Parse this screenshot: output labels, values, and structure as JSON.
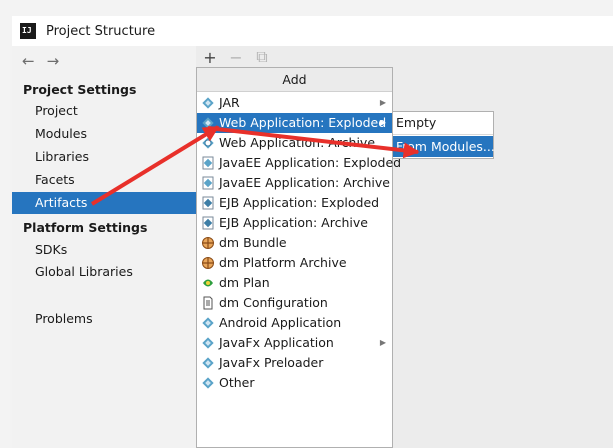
{
  "window": {
    "title": "Project Structure",
    "logo_text": "IJ"
  },
  "nav": {
    "back_glyph": "←",
    "forward_glyph": "→"
  },
  "sidebar": {
    "project_settings_head": "Project Settings",
    "project_settings_items": [
      "Project",
      "Modules",
      "Libraries",
      "Facets",
      "Artifacts"
    ],
    "platform_settings_head": "Platform Settings",
    "platform_settings_items": [
      "SDKs",
      "Global Libraries"
    ],
    "other_items": [
      "Problems"
    ],
    "selected": "Artifacts"
  },
  "toolbar": {
    "add_glyph": "+",
    "remove_glyph": "−",
    "copy_glyph": "⧉"
  },
  "add_popup": {
    "header": "Add",
    "items": [
      {
        "label": "JAR",
        "icon": "diamond-icon",
        "submenu": true
      },
      {
        "label": "Web Application: Exploded",
        "icon": "diamond-icon",
        "submenu": true,
        "selected": true
      },
      {
        "label": "Web Application: Archive",
        "icon": "web-archive-icon"
      },
      {
        "label": "JavaEE Application: Exploded",
        "icon": "javaee-icon"
      },
      {
        "label": "JavaEE Application: Archive",
        "icon": "javaee-icon"
      },
      {
        "label": "EJB Application: Exploded",
        "icon": "ejb-icon"
      },
      {
        "label": "EJB Application: Archive",
        "icon": "ejb-icon"
      },
      {
        "label": "dm Bundle",
        "icon": "bundle-icon"
      },
      {
        "label": "dm Platform Archive",
        "icon": "bundle-icon"
      },
      {
        "label": "dm Plan",
        "icon": "plan-icon"
      },
      {
        "label": "dm Configuration",
        "icon": "config-file-icon"
      },
      {
        "label": "Android Application",
        "icon": "diamond-icon"
      },
      {
        "label": "JavaFx Application",
        "icon": "diamond-icon",
        "submenu": true
      },
      {
        "label": "JavaFx Preloader",
        "icon": "diamond-icon"
      },
      {
        "label": "Other",
        "icon": "diamond-icon"
      }
    ]
  },
  "submenu": {
    "items": [
      {
        "label": "Empty"
      },
      {
        "label": "From Modules...",
        "selected": true
      }
    ]
  },
  "colors": {
    "selection": "#2675bf",
    "annotation_arrow": "#e8302a",
    "icon_teal": "#5aa3c8"
  }
}
